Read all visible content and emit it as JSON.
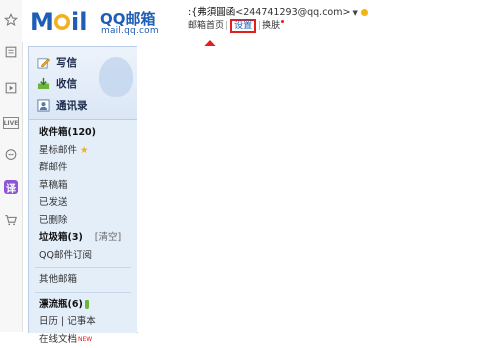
{
  "rail": {
    "icons": [
      "star-icon",
      "bookmark-icon",
      "play-icon",
      "live-icon",
      "chat-icon",
      "translate-icon",
      "cart-icon"
    ],
    "live_label": "LIVE",
    "translate_label": "译"
  },
  "header": {
    "logo_main": "M il",
    "logo_qqmail": "QQ邮箱",
    "logo_domain": "mail.qq.com",
    "user_name": ":{弗須圓函",
    "user_email": "<244741293@qq.com>",
    "user_dropdown": "▼",
    "nav": {
      "home": "邮箱首页",
      "settings": "设置",
      "skin": "换肤"
    }
  },
  "annotation": {
    "color": "#e02020"
  },
  "sidebar": {
    "quick_actions": [
      {
        "label": "写信",
        "icon": "pen-icon"
      },
      {
        "label": "收信",
        "icon": "inbox-icon"
      },
      {
        "label": "通讯录",
        "icon": "contacts-icon"
      }
    ],
    "folders": {
      "inbox": "收件箱(120)",
      "starred": "星标邮件",
      "group": "群邮件",
      "drafts": "草稿箱",
      "sent": "已发送",
      "deleted": "已删除",
      "trash": "垃圾箱(3)",
      "trash_clear": "[清空]",
      "subscriptions": "QQ邮件订阅",
      "other": "其他邮箱",
      "bottle": "漂流瓶(6)",
      "calendar": "日历",
      "notes_sep": "|",
      "notes": "记事本",
      "files": "在线文档",
      "files_badge": "NEW"
    }
  },
  "colors": {
    "brand_blue": "#1e5eb5",
    "panel_bg": "#e4eef9",
    "arrow_red": "#e02020"
  }
}
